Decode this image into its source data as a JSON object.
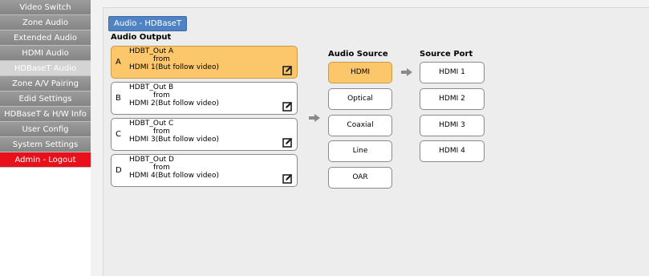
{
  "sidebar": {
    "items": [
      {
        "label": "Video Switch"
      },
      {
        "label": "Zone Audio"
      },
      {
        "label": "Extended Audio"
      },
      {
        "label": "HDMI Audio"
      },
      {
        "label": "HDBaseT Audio",
        "active": true
      },
      {
        "label": "Zone A/V Pairing"
      },
      {
        "label": "Edid Settings"
      },
      {
        "label": "HDBaseT & H/W Info"
      },
      {
        "label": "User Config"
      },
      {
        "label": "System Settings"
      },
      {
        "label": "Admin - Logout",
        "logout": true
      }
    ]
  },
  "panel": {
    "title": "Audio - HDBaseT",
    "audio_output_label": "Audio Output",
    "audio_source_label": "Audio Source",
    "source_port_label": "Source Port"
  },
  "outputs": [
    {
      "letter": "A",
      "name": "HDBT_Out A",
      "from": "from",
      "source": "HDMI 1(But follow video)",
      "selected": true
    },
    {
      "letter": "B",
      "name": "HDBT_Out B",
      "from": "from",
      "source": "HDMI 2(But follow video)"
    },
    {
      "letter": "C",
      "name": "HDBT_Out C",
      "from": "from",
      "source": "HDMI 3(But follow video)"
    },
    {
      "letter": "D",
      "name": "HDBT_Out D",
      "from": "from",
      "source": "HDMI 4(But follow video)"
    }
  ],
  "audio_sources": [
    {
      "label": "HDMI",
      "selected": true
    },
    {
      "label": "Optical"
    },
    {
      "label": "Coaxial"
    },
    {
      "label": "Line"
    },
    {
      "label": "OAR"
    }
  ],
  "source_ports": [
    {
      "label": "HDMI 1"
    },
    {
      "label": "HDMI 2"
    },
    {
      "label": "HDMI 3"
    },
    {
      "label": "HDMI 4"
    }
  ],
  "colors": {
    "selected": "#fcc66a",
    "tab": "#4f83c3",
    "logout": "#e8101a",
    "nav": "#8e8e8e"
  },
  "icons": {
    "edit": "edit-icon",
    "arrow": "arrow-right-icon"
  }
}
